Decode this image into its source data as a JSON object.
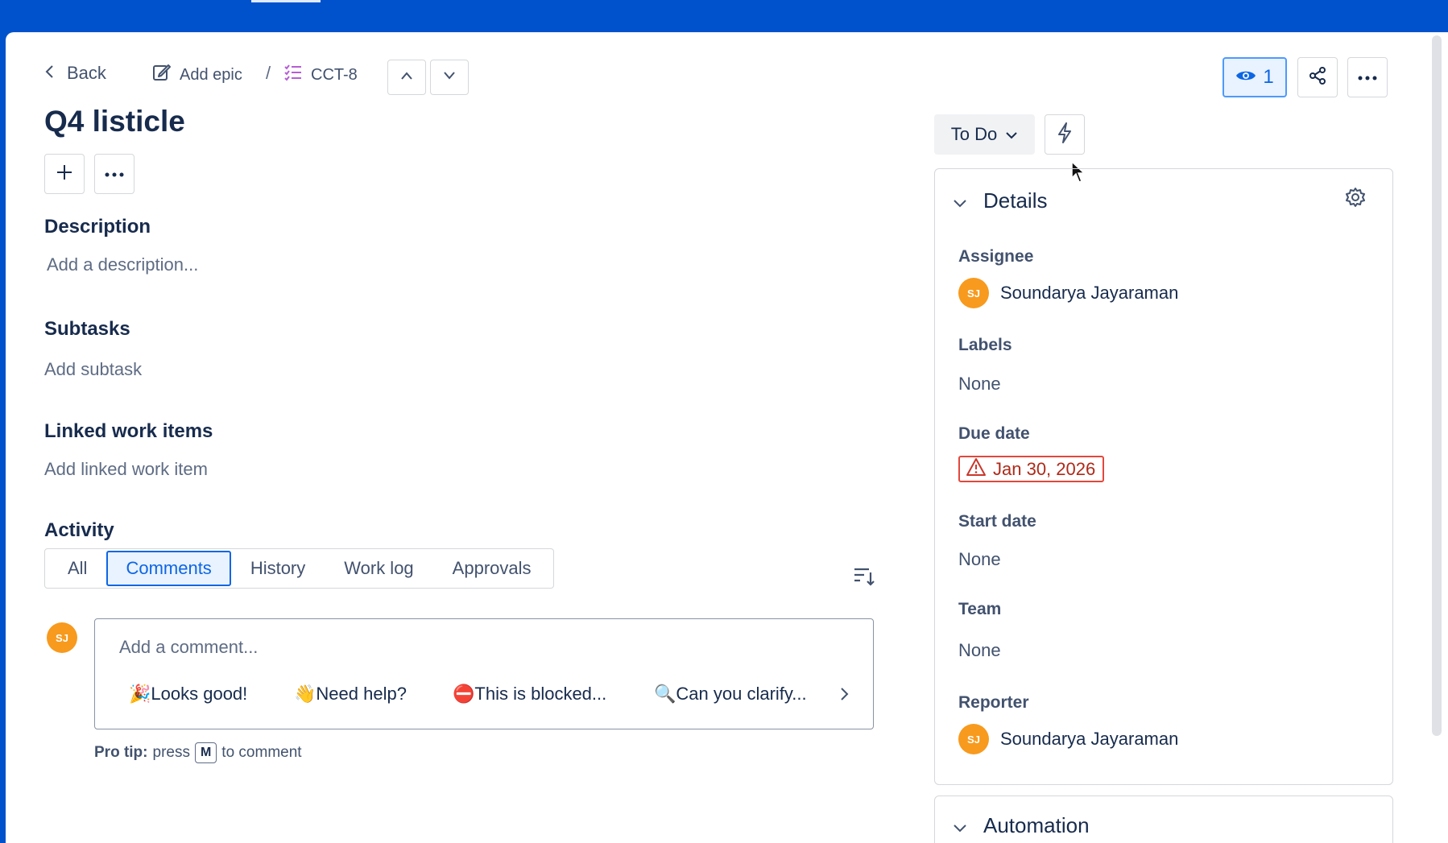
{
  "nav": {
    "back": "Back",
    "add_epic": "Add epic",
    "separator": "/",
    "issue_key": "CCT-8"
  },
  "header": {
    "watchers_count": "1"
  },
  "issue": {
    "title": "Q4 listicle"
  },
  "sections": {
    "description": {
      "heading": "Description",
      "placeholder": "Add a description..."
    },
    "subtasks": {
      "heading": "Subtasks",
      "action": "Add subtask"
    },
    "linked": {
      "heading": "Linked work items",
      "action": "Add linked work item"
    },
    "activity": {
      "heading": "Activity",
      "tabs": [
        "All",
        "Comments",
        "History",
        "Work log",
        "Approvals"
      ],
      "active_tab": "Comments"
    }
  },
  "comment": {
    "avatar_initials": "SJ",
    "placeholder": "Add a comment...",
    "quick_replies": [
      {
        "emoji": "🎉",
        "text": "Looks good!"
      },
      {
        "emoji": "👋",
        "text": "Need help?"
      },
      {
        "emoji": "⛔",
        "text": "This is blocked..."
      },
      {
        "emoji": "🔍",
        "text": "Can you clarify..."
      }
    ],
    "pro_tip_label": "Pro tip:",
    "pro_tip_press": "press",
    "pro_tip_key": "M",
    "pro_tip_suffix": "to comment"
  },
  "status": {
    "value": "To Do"
  },
  "details": {
    "heading": "Details",
    "assignee_label": "Assignee",
    "assignee_name": "Soundarya Jayaraman",
    "assignee_initials": "SJ",
    "labels_label": "Labels",
    "labels_value": "None",
    "due_label": "Due date",
    "due_value": "Jan 30, 2026",
    "start_label": "Start date",
    "start_value": "None",
    "team_label": "Team",
    "team_value": "None",
    "reporter_label": "Reporter",
    "reporter_name": "Soundarya Jayaraman",
    "reporter_initials": "SJ"
  },
  "automation": {
    "heading": "Automation"
  },
  "colors": {
    "brand": "#0052cc",
    "accent": "#0c66e4",
    "avatar": "#f79a1e",
    "overdue": "#ae2a19"
  }
}
